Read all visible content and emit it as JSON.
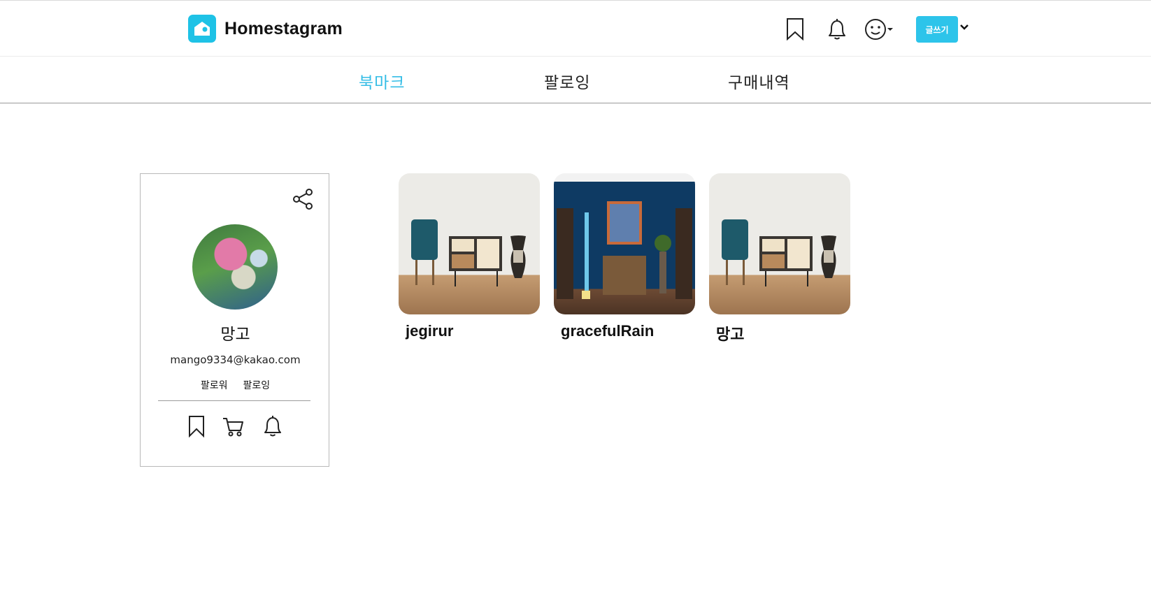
{
  "header": {
    "brand": "Homestagram",
    "write_button": "글쓰기",
    "icons": [
      "bookmark-icon",
      "bell-icon",
      "smile-icon",
      "chevron-down-icon",
      "home-logo-icon"
    ],
    "accent_color": "#2dc4ea"
  },
  "tabs": [
    {
      "label": "북마크",
      "active": true
    },
    {
      "label": "팔로잉",
      "active": false
    },
    {
      "label": "구매내역",
      "active": false
    }
  ],
  "profile": {
    "name": "망고",
    "email": "mango9334@kakao.com",
    "follower_label": "팔로워",
    "following_label": "팔로잉",
    "action_icons": [
      "bookmark-icon",
      "cart-icon",
      "bell-icon"
    ],
    "share_icon": "share-icon"
  },
  "bookmarks": [
    {
      "author": "jegirur"
    },
    {
      "author": "gracefulRain"
    },
    {
      "author": "망고"
    }
  ]
}
